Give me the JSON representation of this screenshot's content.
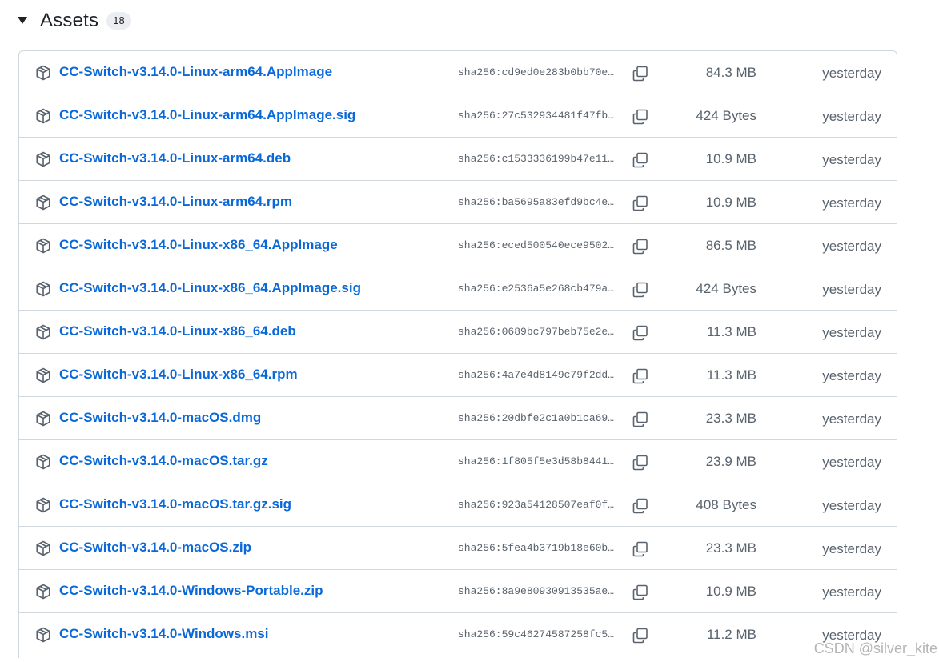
{
  "header": {
    "title": "Assets",
    "count": "18"
  },
  "assets": [
    {
      "name": "CC-Switch-v3.14.0-Linux-arm64.AppImage",
      "sha": "sha256:cd9ed0e283b0bb70e…",
      "size": "84.3 MB",
      "date": "yesterday"
    },
    {
      "name": "CC-Switch-v3.14.0-Linux-arm64.AppImage.sig",
      "sha": "sha256:27c532934481f47fb…",
      "size": "424 Bytes",
      "date": "yesterday"
    },
    {
      "name": "CC-Switch-v3.14.0-Linux-arm64.deb",
      "sha": "sha256:c1533336199b47e11…",
      "size": "10.9 MB",
      "date": "yesterday"
    },
    {
      "name": "CC-Switch-v3.14.0-Linux-arm64.rpm",
      "sha": "sha256:ba5695a83efd9bc4e…",
      "size": "10.9 MB",
      "date": "yesterday"
    },
    {
      "name": "CC-Switch-v3.14.0-Linux-x86_64.AppImage",
      "sha": "sha256:eced500540ece9502…",
      "size": "86.5 MB",
      "date": "yesterday"
    },
    {
      "name": "CC-Switch-v3.14.0-Linux-x86_64.AppImage.sig",
      "sha": "sha256:e2536a5e268cb479a…",
      "size": "424 Bytes",
      "date": "yesterday"
    },
    {
      "name": "CC-Switch-v3.14.0-Linux-x86_64.deb",
      "sha": "sha256:0689bc797beb75e2e…",
      "size": "11.3 MB",
      "date": "yesterday"
    },
    {
      "name": "CC-Switch-v3.14.0-Linux-x86_64.rpm",
      "sha": "sha256:4a7e4d8149c79f2dd…",
      "size": "11.3 MB",
      "date": "yesterday"
    },
    {
      "name": "CC-Switch-v3.14.0-macOS.dmg",
      "sha": "sha256:20dbfe2c1a0b1ca69…",
      "size": "23.3 MB",
      "date": "yesterday"
    },
    {
      "name": "CC-Switch-v3.14.0-macOS.tar.gz",
      "sha": "sha256:1f805f5e3d58b8441…",
      "size": "23.9 MB",
      "date": "yesterday"
    },
    {
      "name": "CC-Switch-v3.14.0-macOS.tar.gz.sig",
      "sha": "sha256:923a54128507eaf0f…",
      "size": "408 Bytes",
      "date": "yesterday"
    },
    {
      "name": "CC-Switch-v3.14.0-macOS.zip",
      "sha": "sha256:5fea4b3719b18e60b…",
      "size": "23.3 MB",
      "date": "yesterday"
    },
    {
      "name": "CC-Switch-v3.14.0-Windows-Portable.zip",
      "sha": "sha256:8a9e80930913535ae…",
      "size": "10.9 MB",
      "date": "yesterday"
    },
    {
      "name": "CC-Switch-v3.14.0-Windows.msi",
      "sha": "sha256:59c46274587258fc5…",
      "size": "11.2 MB",
      "date": "yesterday"
    }
  ],
  "watermark": "CSDN @silver_kite",
  "colors": {
    "link": "#0969da",
    "muted": "#59636e",
    "border": "#d0d7de"
  },
  "icons": {
    "caret": "triangle-down-icon",
    "package": "package-icon",
    "copy": "copy-icon"
  }
}
